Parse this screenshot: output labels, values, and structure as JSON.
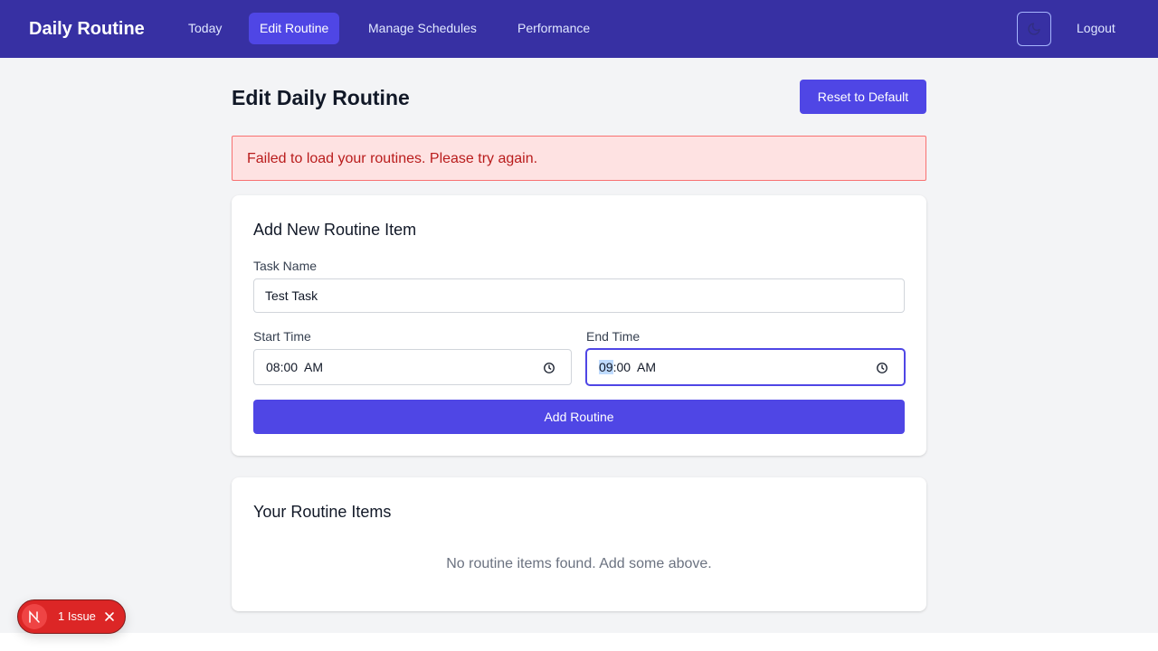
{
  "nav": {
    "brand": "Daily Routine",
    "links": [
      "Today",
      "Edit Routine",
      "Manage Schedules",
      "Performance"
    ],
    "active_index": 1,
    "logout": "Logout",
    "theme_icon": "moon-icon"
  },
  "page": {
    "title": "Edit Daily Routine",
    "reset_label": "Reset to Default"
  },
  "alert": {
    "message": "Failed to load your routines. Please try again."
  },
  "add_form": {
    "title": "Add New Routine Item",
    "task_label": "Task Name",
    "task_value": "Test Task",
    "start_label": "Start Time",
    "start_hour": "08",
    "start_rest": ":00  AM",
    "end_label": "End Time",
    "end_hour": "09",
    "end_rest": ":00  AM",
    "submit_label": "Add Routine",
    "clock_icon": "clock-icon"
  },
  "routine_list": {
    "title": "Your Routine Items",
    "empty_message": "No routine items found. Add some above."
  },
  "dev_badge": {
    "text": "1 Issue",
    "logo_icon": "nextjs-logo-icon",
    "close_icon": "close-icon"
  },
  "colors": {
    "nav_bg": "#3730a3",
    "accent": "#4f46e5",
    "alert_bg": "#fee2e2",
    "alert_text": "#b91c1c",
    "page_bg": "#f3f4f6",
    "badge_bg": "#dc2626"
  }
}
